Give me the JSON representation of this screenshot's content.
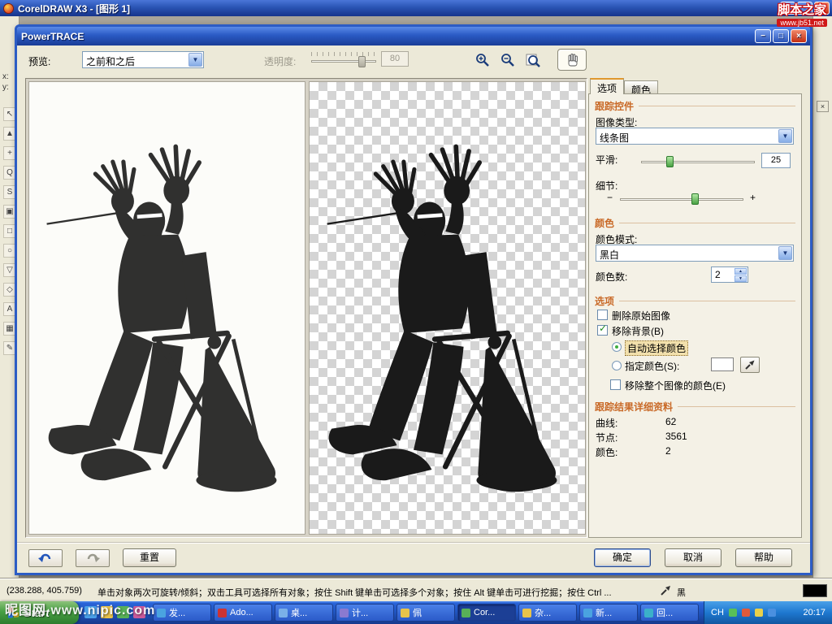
{
  "window": {
    "title": "CorelDRAW X3 - [图形 1]",
    "brand": {
      "line1": "脚本之家",
      "line2": "www.jb51.net"
    },
    "x_label": "x:",
    "y_label": "y:"
  },
  "icons": {
    "minimize": "−",
    "maximize": "□",
    "close": "×",
    "dropdown": "▼",
    "spin_up": "▲",
    "spin_down": "▼",
    "check": "✓",
    "docker_close": "×",
    "toolbox": [
      "↖",
      "▲",
      "+",
      "Q",
      "S",
      "▣",
      "□",
      "○",
      "▽",
      "◇",
      "A",
      "▦",
      "✎"
    ]
  },
  "dialog": {
    "title": "PowerTRACE",
    "preview": {
      "label": "预览:",
      "value": "之前和之后"
    },
    "transparency": {
      "label": "透明度:",
      "value": "80"
    },
    "tabs": {
      "options": "选项",
      "colors": "颜色"
    },
    "trace_controls": {
      "heading": "跟踪控件",
      "image_type_label": "图像类型:",
      "image_type_value": "线条图",
      "smooth_label": "平滑:",
      "smooth_value": "25",
      "detail_label": "细节:",
      "detail_minus": "−",
      "detail_plus": "+"
    },
    "color_section": {
      "heading": "颜色",
      "mode_label": "颜色模式:",
      "mode_value": "黑白",
      "count_label": "颜色数:",
      "count_value": "2"
    },
    "options_section": {
      "heading": "选项",
      "delete_original_label": "删除原始图像",
      "remove_background_label": "移除背景(B)",
      "auto_color_label": "自动选择颜色",
      "specify_color_label": "指定颜色(S):",
      "remove_entire_label": "移除整个图像的颜色(E)"
    },
    "results": {
      "heading": "跟踪结果详细资料",
      "rows": [
        {
          "label": "曲线:",
          "value": "62"
        },
        {
          "label": "节点:",
          "value": "3561"
        },
        {
          "label": "颜色:",
          "value": "2"
        }
      ]
    },
    "footer": {
      "reset": "重置",
      "ok": "确定",
      "cancel": "取消",
      "help": "帮助"
    }
  },
  "statusbar": {
    "coords": "(238.288, 405.759)",
    "hint": "单击对象两次可旋转/倾斜；双击工具可选择所有对象；按住 Shift 键单击可选择多个对象；按住 Alt 键单击可进行挖掘；按住 Ctrl ...",
    "fill_color_label": "黑"
  },
  "watermark": "昵图网  www.nipic.com",
  "taskbar": {
    "start_label": "Start",
    "items": [
      {
        "label": "发..."
      },
      {
        "label": "Ado..."
      },
      {
        "label": "桌..."
      },
      {
        "label": "计..."
      },
      {
        "label": "佩"
      },
      {
        "label": "Cor..."
      },
      {
        "label": "杂..."
      },
      {
        "label": "新..."
      },
      {
        "label": "回..."
      }
    ],
    "tray": {
      "ime": "CH",
      "time": "20:17"
    }
  }
}
